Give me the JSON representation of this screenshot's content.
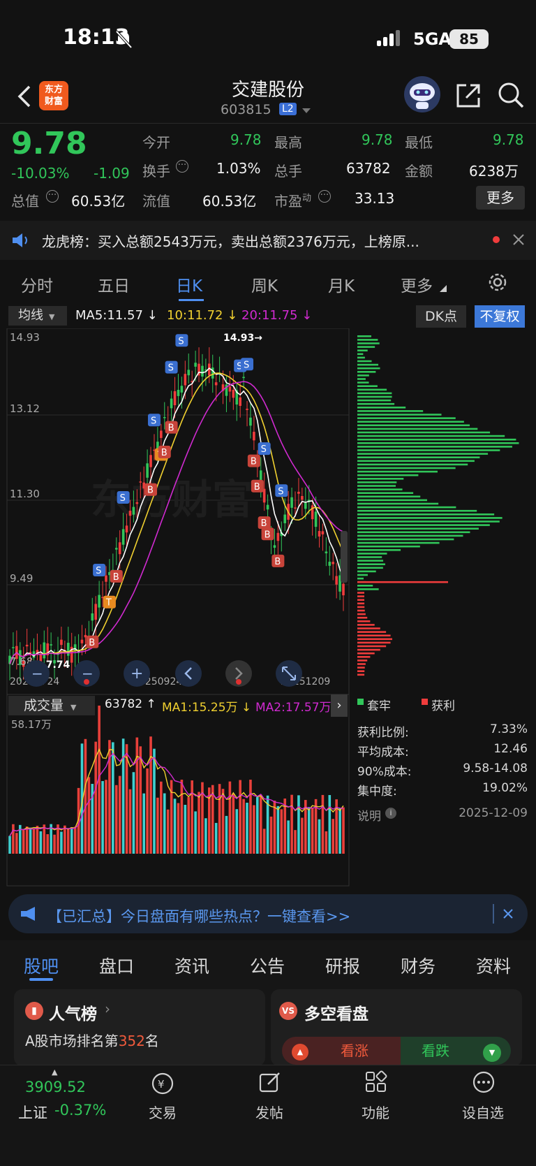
{
  "status_bar": {
    "time": "18:13",
    "network": "5GA",
    "battery": "85"
  },
  "header": {
    "logo": "东方\n财富",
    "name": "交建股份",
    "code": "603815",
    "level": "L2"
  },
  "quote": {
    "price": "9.78",
    "change_pct": "-10.03%",
    "change": "-1.09",
    "rows": [
      {
        "l1": "今开",
        "v1": "9.78",
        "l2": "最高",
        "v2": "9.78",
        "l3": "最低",
        "v3": "9.78"
      },
      {
        "l1": "换手",
        "v1": "1.03%",
        "l2": "总手",
        "v2": "63782",
        "l3": "金额",
        "v3": "6238万"
      },
      {
        "l0": "总值",
        "v0": "60.53亿",
        "l1": "流值",
        "v1": "60.53亿",
        "l2": "市盈",
        "l2sup": "动",
        "v2": "33.13"
      }
    ],
    "more_button": "更多"
  },
  "ticker": "龙虎榜：买入总额2543万元，卖出总额2376万元，上榜原...",
  "period_tabs": [
    "分时",
    "五日",
    "日K",
    "周K",
    "月K",
    "更多"
  ],
  "indicators": {
    "select": "均线",
    "ma5": "MA5:11.57",
    "ma10": "10:11.72",
    "ma20": "20:11.75",
    "dk_button": "DK点",
    "fuquan_button": "不复权"
  },
  "colors": {
    "up": "#f03c3c",
    "down": "#31c65a",
    "accent": "#4f8ff0",
    "ma5": "#ffffff",
    "ma10": "#f0d030",
    "ma20": "#d02ad0",
    "vol_up": "#e8403a",
    "vol_down": "#3fd0d0"
  },
  "chart_data": {
    "type": "candlestick",
    "y_ticks": [
      "14.93",
      "13.12",
      "11.30",
      "9.49",
      "7.68"
    ],
    "ylim": [
      7.68,
      14.93
    ],
    "high_label": "14.93",
    "low_label": "7.74",
    "volume_max_label": "58.17万",
    "x_ticks": [
      "20250724",
      "20250924",
      "20251209"
    ],
    "volume_indicators": {
      "select": "成交量",
      "vol": "63782",
      "ma1": "MA1:15.25万",
      "ma2": "MA2:17.57万"
    }
  },
  "chip_stats": {
    "legend": [
      "套牢",
      "获利"
    ],
    "rows": [
      {
        "label": "获利比例:",
        "value": "7.33%"
      },
      {
        "label": "平均成本:",
        "value": "12.46"
      },
      {
        "label": "90%成本:",
        "value": "9.58-14.08"
      },
      {
        "label": "集中度:",
        "value": "19.02%"
      }
    ],
    "note_label": "说明",
    "date": "2025-12-09"
  },
  "banner": "【已汇总】今日盘面有哪些热点？一键查看>>",
  "bottom_tabs": [
    "股吧",
    "盘口",
    "资讯",
    "公告",
    "研报",
    "财务",
    "资料"
  ],
  "cards": {
    "left_title": "人气榜",
    "left_line1_pre": "A股市场排名第",
    "left_rank": "352",
    "left_line1_post": "名",
    "right_title": "多空看盘",
    "bull": "看涨",
    "bear": "看跌"
  },
  "bottom_nav": {
    "index_value": "3909.52",
    "index_name": "上证",
    "index_change": "-0.37%",
    "items": [
      "交易",
      "发帖",
      "功能",
      "设自选"
    ]
  }
}
